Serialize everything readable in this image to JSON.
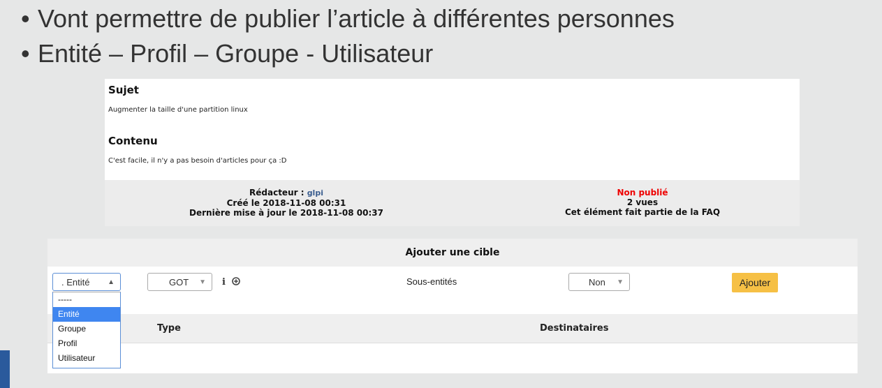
{
  "slide": {
    "bullets": [
      "Vont permettre de publier l’article à différentes personnes",
      "Entité – Profil – Groupe - Utilisateur"
    ],
    "bullet_symbol": "•"
  },
  "article": {
    "subject_heading": "Sujet",
    "subject_text": "Augmenter la taille d'une partition linux",
    "content_heading": "Contenu",
    "content_text": "C'est facile, il n'y a pas besoin d'articles pour ça :D",
    "meta_left": {
      "author_label": "Rédacteur : ",
      "author_link": "glpi",
      "created": "Créé le 2018-11-08 00:31",
      "updated": "Dernière mise à jour le 2018-11-08 00:37"
    },
    "meta_right": {
      "status": "Non publié",
      "views": "2 vues",
      "faq": "Cet élément fait partie de la FAQ"
    }
  },
  "target": {
    "title": "Ajouter une cible",
    "type_select_value": ". Entité",
    "entity_select_value": "GOT",
    "info_icon": "i",
    "sub_entities_label": "Sous-entités",
    "sub_entities_value": "Non",
    "add_button": "Ajouter",
    "columns": {
      "type": "Type",
      "recipients": "Destinataires"
    },
    "dropdown_options": [
      "-----",
      "Entité",
      "Groupe",
      "Profil",
      "Utilisateur"
    ],
    "dropdown_selected_index": 1
  },
  "colors": {
    "slide_bg": "#e6e7e7",
    "accent_blue": "#2a5a9c",
    "button_yellow": "#f6c045",
    "status_red": "#ee0000",
    "dropdown_selection": "#3f86f0"
  }
}
